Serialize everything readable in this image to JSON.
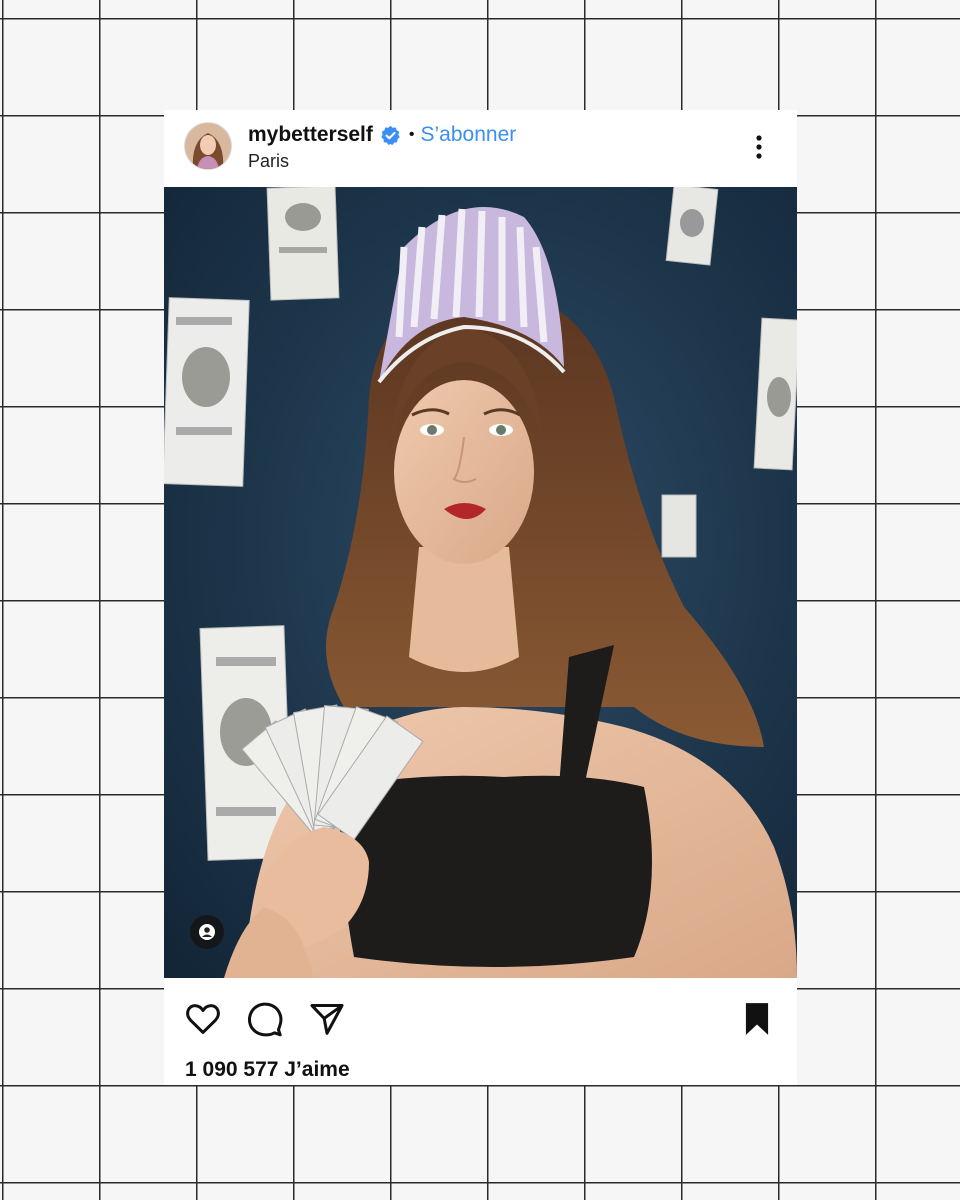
{
  "post": {
    "username": "mybetterself",
    "separator": "•",
    "follow_label": "S’abonner",
    "location": "Paris",
    "likes_text": "1 090 577 J’aime"
  },
  "icons": {
    "verified": "verified-badge-icon",
    "more": "more-vertical-icon",
    "like": "heart-icon",
    "comment": "comment-icon",
    "share": "send-icon",
    "save": "bookmark-icon",
    "tags": "user-tag-icon"
  },
  "colors": {
    "follow": "#3b8ff2",
    "verified": "#3b8ff2",
    "photo_background": "#1d3448"
  }
}
